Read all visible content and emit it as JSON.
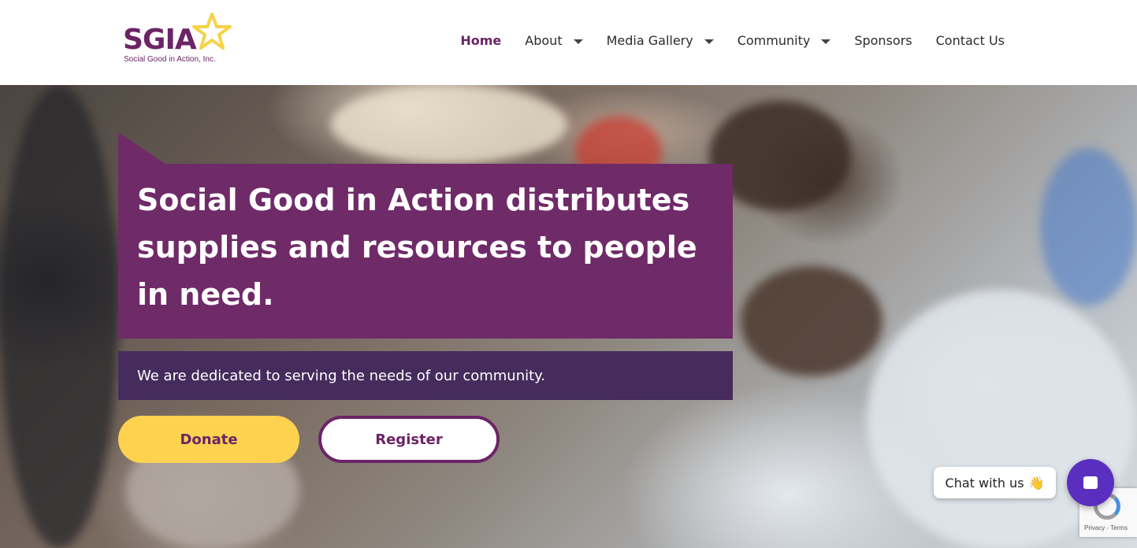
{
  "logo": {
    "title": "SGIA",
    "subtitle": "Social Good in Action, Inc."
  },
  "nav": {
    "items": [
      {
        "label": "Home",
        "active": true,
        "dropdown": false
      },
      {
        "label": "About",
        "active": false,
        "dropdown": true
      },
      {
        "label": "Media Gallery",
        "active": false,
        "dropdown": true
      },
      {
        "label": "Community",
        "active": false,
        "dropdown": true
      },
      {
        "label": "Sponsors",
        "active": false,
        "dropdown": false
      },
      {
        "label": "Contact Us",
        "active": false,
        "dropdown": false
      }
    ]
  },
  "hero": {
    "headline": "Social Good in Action distributes supplies and resources to people in need.",
    "subheadline": "We are dedicated to serving the needs of our community.",
    "donate_label": "Donate",
    "register_label": "Register"
  },
  "chat": {
    "label": "Chat with us",
    "emoji": "👋"
  },
  "recaptcha": {
    "text": "Privacy - Terms"
  },
  "colors": {
    "brand_purple": "#6b2466",
    "headline_bg": "#6f2a68",
    "sub_bg": "#452c5c",
    "donate_yellow": "#fcd24f",
    "chat_purple": "#5a2fc0",
    "star_yellow": "#f5d34a"
  }
}
